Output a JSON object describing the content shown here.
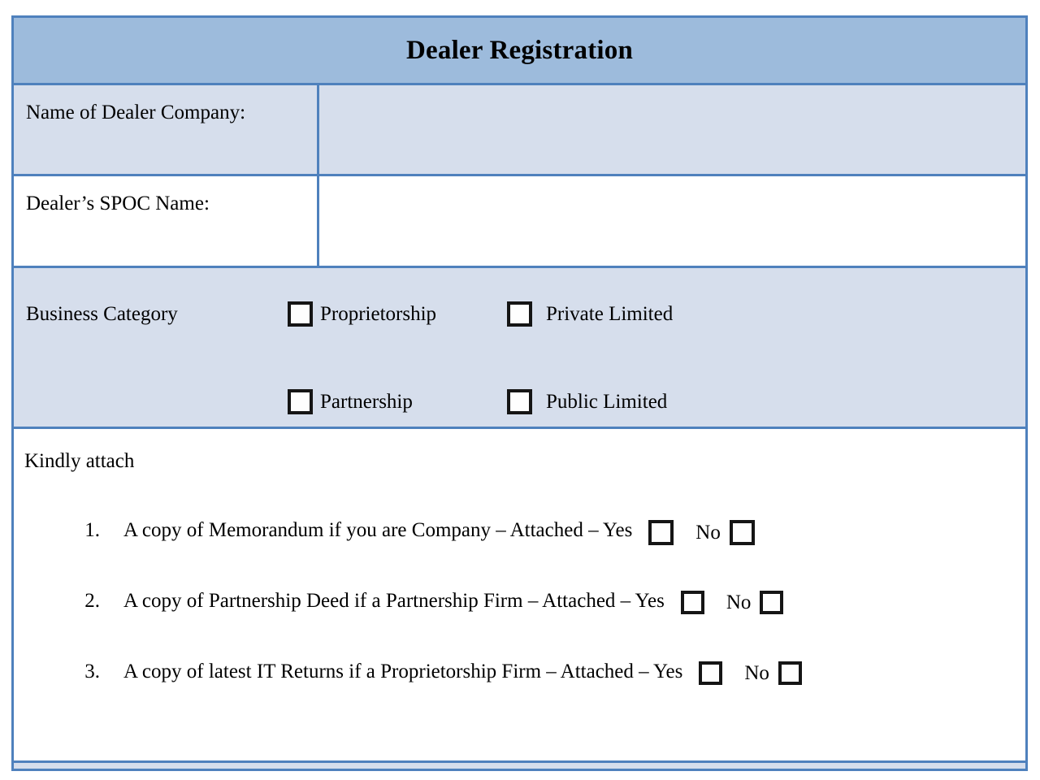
{
  "form": {
    "title": "Dealer Registration",
    "fields": [
      {
        "label": "Name of Dealer Company:",
        "value": ""
      },
      {
        "label": "Dealer’s SPOC Name:",
        "value": ""
      }
    ],
    "business_category": {
      "label": "Business Category",
      "options": [
        {
          "label": "Proprietorship",
          "checked": false
        },
        {
          "label": "Private Limited",
          "checked": false
        },
        {
          "label": "Partnership",
          "checked": false
        },
        {
          "label": "Public Limited",
          "checked": false
        }
      ]
    },
    "attachments": {
      "heading": "Kindly attach",
      "yes_label": "Yes",
      "no_label": "No",
      "items": [
        {
          "number": "1.",
          "text": "A copy of Memorandum if you are Company – Attached – Yes",
          "yes_checked": false,
          "no_checked": false
        },
        {
          "number": "2.",
          "text": "A copy of Partnership Deed if a Partnership Firm – Attached – Yes",
          "yes_checked": false,
          "no_checked": false
        },
        {
          "number": "3.",
          "text": "A copy of latest IT Returns if a Proprietorship Firm – Attached – Yes",
          "yes_checked": false,
          "no_checked": false
        }
      ]
    }
  },
  "colors": {
    "header_fill": "#9DBBDC",
    "row_fill": "#D6DEEC",
    "border": "#4F81BD",
    "checkbox_border": "#151515",
    "text": "#000000"
  }
}
